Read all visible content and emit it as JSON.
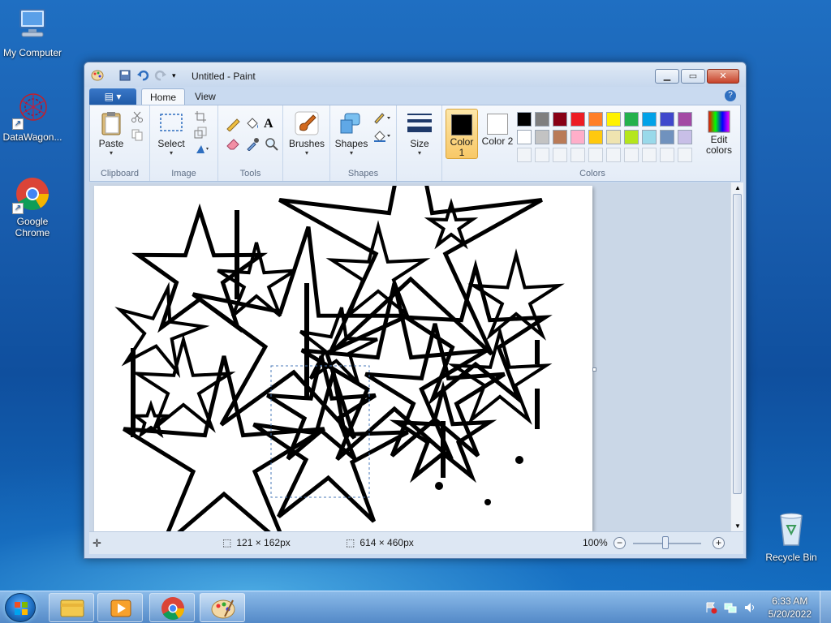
{
  "desktop": {
    "icons": [
      {
        "label": "My Computer"
      },
      {
        "label": "DataWagon..."
      },
      {
        "label": "Google Chrome"
      },
      {
        "label": "Recycle Bin"
      }
    ]
  },
  "window": {
    "title": "Untitled - Paint",
    "tabs": [
      {
        "label": "Home"
      },
      {
        "label": "View"
      }
    ],
    "help": "?",
    "groups": {
      "clipboard": {
        "label": "Clipboard",
        "paste": "Paste"
      },
      "image": {
        "label": "Image",
        "select": "Select"
      },
      "tools": {
        "label": "Tools"
      },
      "brushes": {
        "label": "Brushes"
      },
      "shapes": {
        "label": "Shapes",
        "shapes_btn": "Shapes"
      },
      "size": {
        "label": "Size"
      },
      "colors": {
        "label": "Colors",
        "color1": "Color 1",
        "color2": "Color 2",
        "edit": "Edit colors",
        "color1_value": "#000000",
        "color2_value": "#ffffff",
        "palette_row1": [
          "#000000",
          "#7f7f7f",
          "#880015",
          "#ed1c24",
          "#ff7f27",
          "#fff200",
          "#22b14c",
          "#00a2e8",
          "#3f48cc",
          "#a349a4"
        ],
        "palette_row2": [
          "#ffffff",
          "#c3c3c3",
          "#b97a57",
          "#ffaec9",
          "#ffc90e",
          "#efe4b0",
          "#b5e61d",
          "#99d9ea",
          "#7092be",
          "#c8bfe7"
        ]
      }
    },
    "status": {
      "selection_size": "121 × 162px",
      "image_size": "614 × 460px",
      "zoom": "100%"
    }
  },
  "taskbar": {
    "time": "6:33 AM",
    "date": "5/20/2022"
  }
}
